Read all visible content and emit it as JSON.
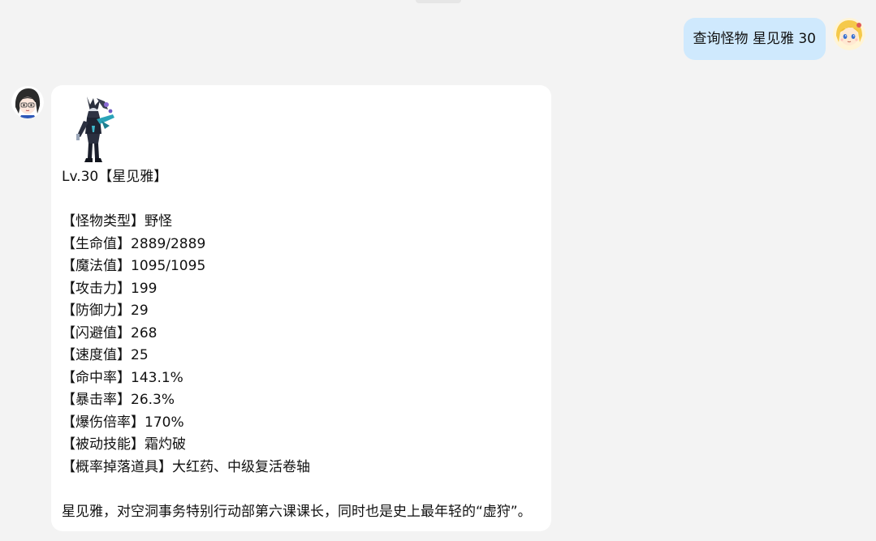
{
  "user_message": {
    "text": "查询怪物 星见雅 30"
  },
  "bot_message": {
    "title": "Lv.30【星见雅】",
    "stats": [
      "【怪物类型】野怪",
      "【生命值】2889/2889",
      "【魔法值】1095/1095",
      "【攻击力】199",
      "【防御力】29",
      "【闪避值】268",
      "【速度值】25",
      "【命中率】143.1%",
      "【暴击率】26.3%",
      "【爆伤倍率】170%",
      "【被动技能】霜灼破",
      "【概率掉落道具】大红药、中级复活卷轴"
    ],
    "description": "星见雅，对空洞事务特别行动部第六课课长，同时也是史上最年轻的“虚狩”。"
  },
  "colors": {
    "background": "#f3f3f3",
    "user_bubble": "#cfe9fd",
    "bot_bubble": "#ffffff"
  },
  "icons": {
    "user_avatar": "blonde-anime-girl-avatar",
    "bot_avatar": "dark-haired-anime-girl-avatar",
    "monster_sprite": "monster-sprite-icon"
  }
}
